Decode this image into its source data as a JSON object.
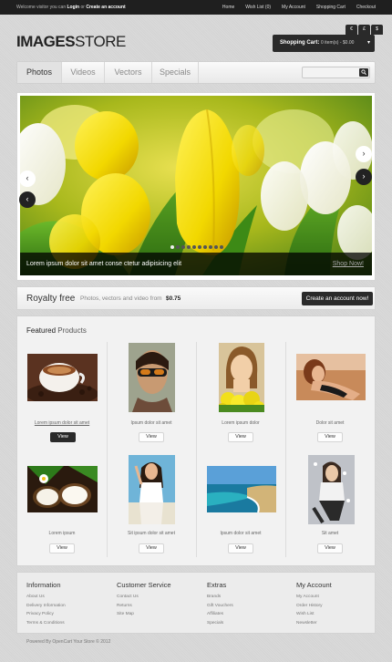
{
  "topbar": {
    "welcome_pre": "Welcome visitor you can",
    "login": "Login",
    "or": "or",
    "create": "Create an account",
    "links": [
      "Home",
      "Wish List (0)",
      "My Account",
      "Shopping Cart",
      "Checkout"
    ]
  },
  "header": {
    "logo_bold": "IMAGES",
    "logo_light": "STORE",
    "currencies": [
      "€",
      "£",
      "$"
    ],
    "cart_label": "Shopping Cart:",
    "cart_value": "0 item(s) - $0.00",
    "cart_arrow": "▾"
  },
  "nav": {
    "tabs": [
      "Photos",
      "Videos",
      "Vectors",
      "Specials"
    ],
    "active": "Photos",
    "search_placeholder": ""
  },
  "slider": {
    "caption": "Lorem ipsum dolor sit amet conse ctetur adipisicing elit",
    "shop_now": "Shop Now!",
    "dot_count": 10,
    "active_dot": 1,
    "arrow_left": "‹",
    "arrow_right": "›"
  },
  "royalty": {
    "title": "Royalty free",
    "subtitle": "Photos, vectors and video from",
    "price": "$0.75",
    "button": "Create an account now!"
  },
  "featured": {
    "title_bold": "Featured",
    "title_light": "Products",
    "products": [
      {
        "name": "Lorem ipsum dolor sit amet",
        "button": "View",
        "image": "coffee-cup"
      },
      {
        "name": "Ipsum dolor sit amet",
        "button": "View",
        "image": "woman-sunglasses"
      },
      {
        "name": "Lorem ipsum dolor",
        "button": "View",
        "image": "woman-flowers"
      },
      {
        "name": "Dolor sit amet",
        "button": "View",
        "image": "woman-lying"
      },
      {
        "name": "Lorem ipsum",
        "button": "View",
        "image": "coconut"
      },
      {
        "name": "Sit ipsum dolor sit amet",
        "button": "View",
        "image": "woman-white-top"
      },
      {
        "name": "Ipsum dolor sit amet",
        "button": "View",
        "image": "beach-coast"
      },
      {
        "name": "Sit amet",
        "button": "View",
        "image": "woman-sitting"
      }
    ]
  },
  "footer": {
    "columns": [
      {
        "heading": "Information",
        "links": [
          "About Us",
          "Delivery Information",
          "Privacy Policy",
          "Terms & Conditions"
        ]
      },
      {
        "heading": "Customer Service",
        "links": [
          "Contact Us",
          "Returns",
          "Site Map"
        ]
      },
      {
        "heading": "Extras",
        "links": [
          "Brands",
          "Gift Vouchers",
          "Affiliates",
          "Specials"
        ]
      },
      {
        "heading": "My Account",
        "links": [
          "My Account",
          "Order History",
          "Wish List",
          "Newsletter"
        ]
      }
    ],
    "powered": "Powered By OpenCart Your Store © 2012"
  }
}
